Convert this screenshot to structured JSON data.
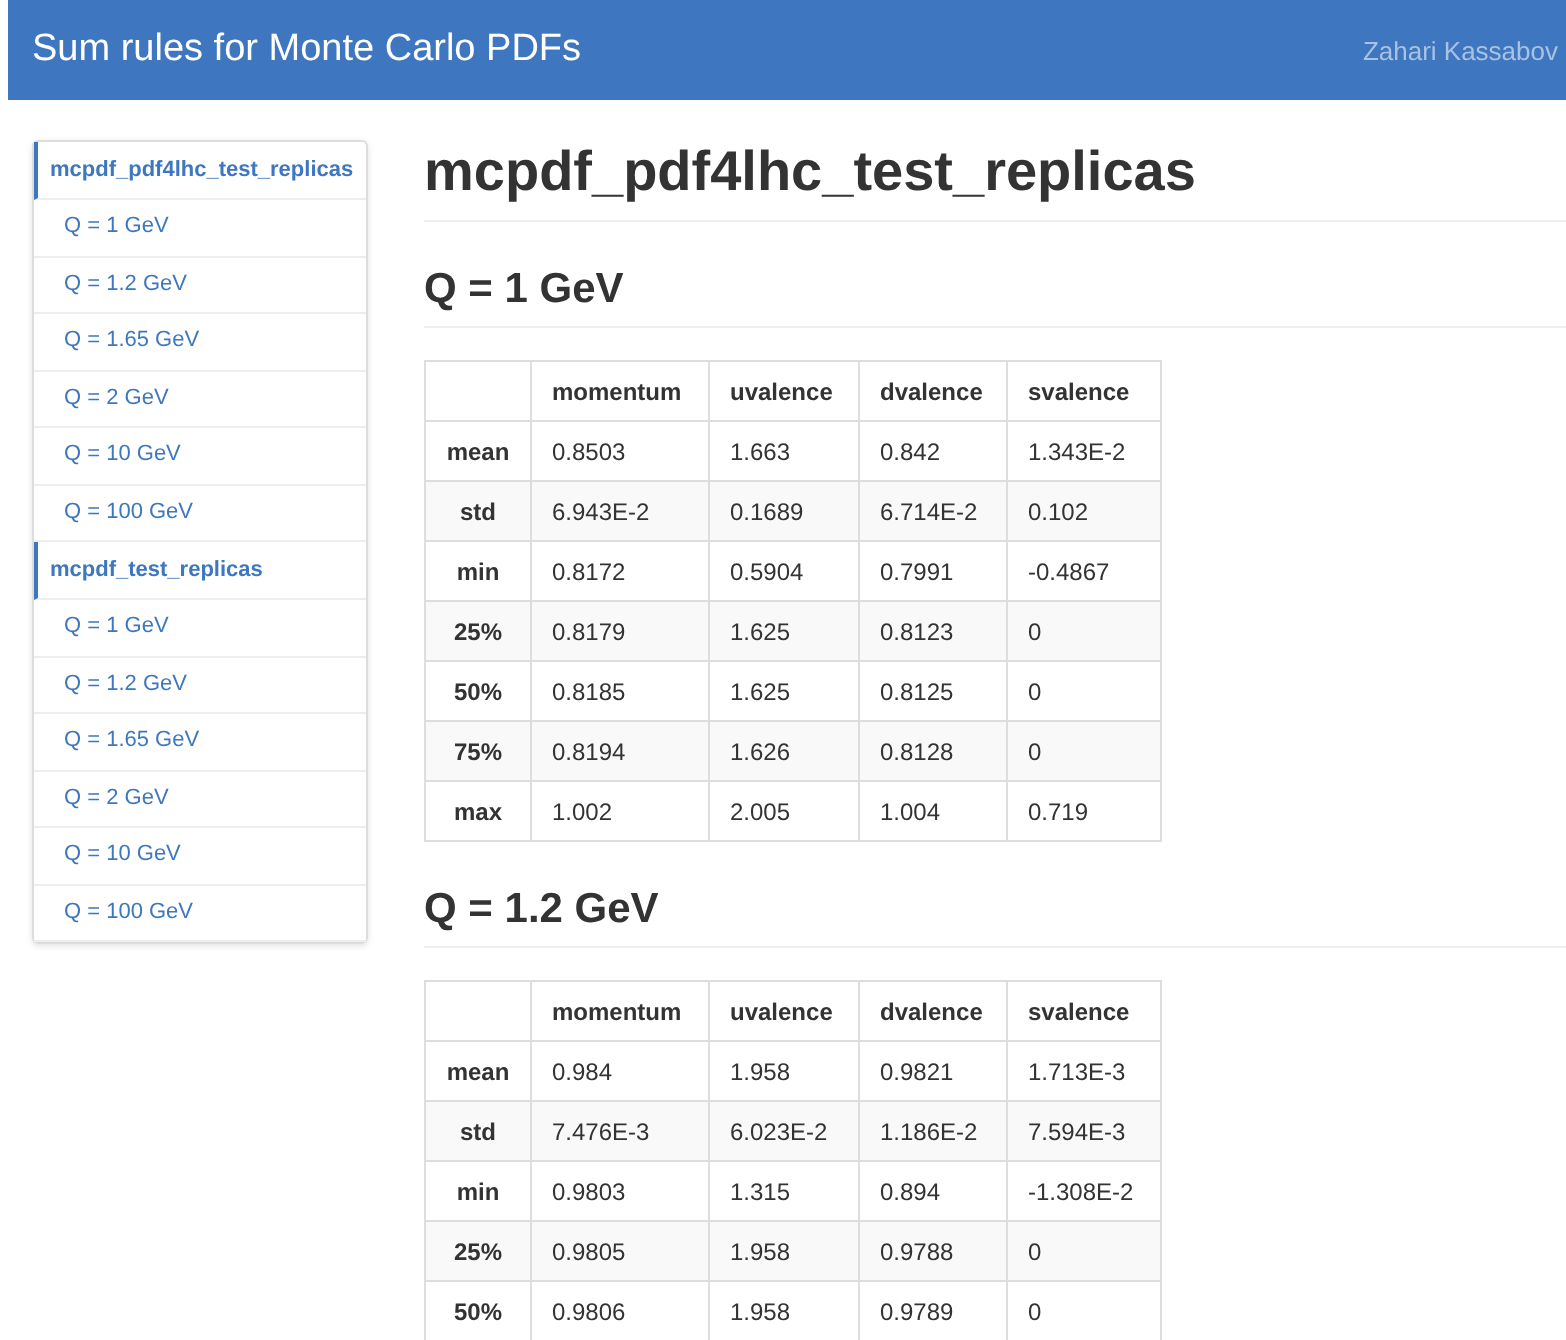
{
  "navbar": {
    "brand": "Sum rules for Monte Carlo PDFs",
    "author": "Zahari Kassabov"
  },
  "sidebar": {
    "groups": [
      {
        "title": "mcpdf_pdf4lhc_test_replicas",
        "items": [
          "Q = 1 GeV",
          "Q = 1.2 GeV",
          "Q = 1.65 GeV",
          "Q = 2 GeV",
          "Q = 10 GeV",
          "Q = 100 GeV"
        ]
      },
      {
        "title": "mcpdf_test_replicas",
        "items": [
          "Q = 1 GeV",
          "Q = 1.2 GeV",
          "Q = 1.65 GeV",
          "Q = 2 GeV",
          "Q = 10 GeV",
          "Q = 100 GeV"
        ]
      }
    ]
  },
  "main": {
    "title": "mcpdf_pdf4lhc_test_replicas",
    "sections": [
      {
        "heading": "Q = 1 GeV",
        "table": {
          "columns": [
            "momentum",
            "uvalence",
            "dvalence",
            "svalence"
          ],
          "rows": [
            {
              "label": "mean",
              "cells": [
                "0.8503",
                "1.663",
                "0.842",
                "1.343E-2"
              ]
            },
            {
              "label": "std",
              "cells": [
                "6.943E-2",
                "0.1689",
                "6.714E-2",
                "0.102"
              ]
            },
            {
              "label": "min",
              "cells": [
                "0.8172",
                "0.5904",
                "0.7991",
                "-0.4867"
              ]
            },
            {
              "label": "25%",
              "cells": [
                "0.8179",
                "1.625",
                "0.8123",
                "0"
              ]
            },
            {
              "label": "50%",
              "cells": [
                "0.8185",
                "1.625",
                "0.8125",
                "0"
              ]
            },
            {
              "label": "75%",
              "cells": [
                "0.8194",
                "1.626",
                "0.8128",
                "0"
              ]
            },
            {
              "label": "max",
              "cells": [
                "1.002",
                "2.005",
                "1.004",
                "0.719"
              ]
            }
          ]
        }
      },
      {
        "heading": "Q = 1.2 GeV",
        "table": {
          "columns": [
            "momentum",
            "uvalence",
            "dvalence",
            "svalence"
          ],
          "rows": [
            {
              "label": "mean",
              "cells": [
                "0.984",
                "1.958",
                "0.9821",
                "1.713E-3"
              ]
            },
            {
              "label": "std",
              "cells": [
                "7.476E-3",
                "6.023E-2",
                "1.186E-2",
                "7.594E-3"
              ]
            },
            {
              "label": "min",
              "cells": [
                "0.9803",
                "1.315",
                "0.894",
                "-1.308E-2"
              ]
            },
            {
              "label": "25%",
              "cells": [
                "0.9805",
                "1.958",
                "0.9788",
                "0"
              ]
            },
            {
              "label": "50%",
              "cells": [
                "0.9806",
                "1.958",
                "0.9789",
                "0"
              ]
            }
          ]
        }
      }
    ]
  }
}
